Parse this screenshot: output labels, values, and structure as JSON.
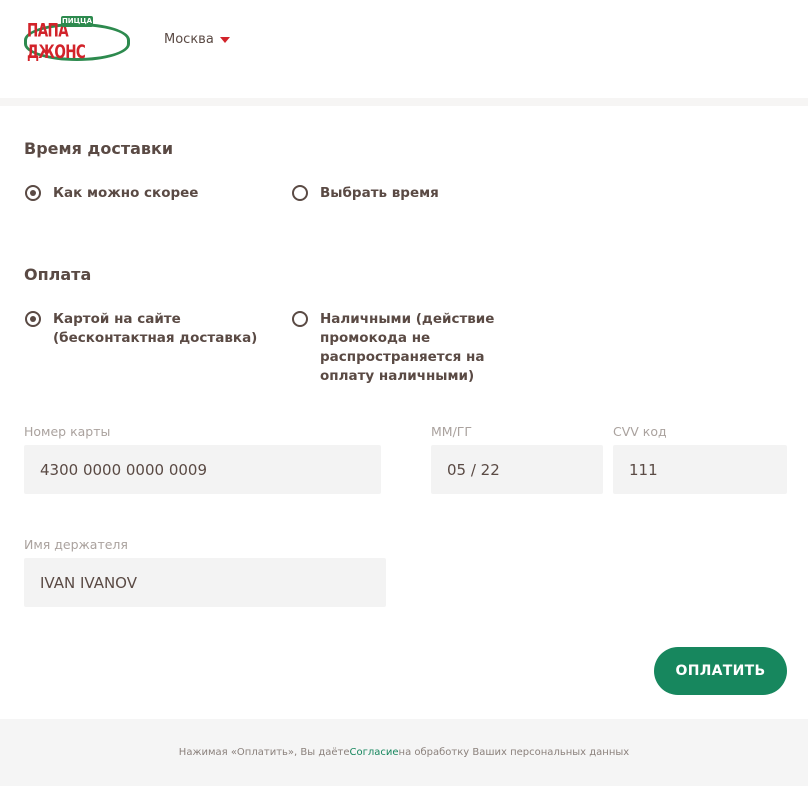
{
  "header": {
    "logo": {
      "banner": "ПИЦЦА",
      "text": "ПАПА ДЖОНС"
    },
    "city": "Москва"
  },
  "delivery": {
    "title": "Время доставки",
    "options": [
      {
        "label": "Как можно скорее",
        "checked": true
      },
      {
        "label": "Выбрать время",
        "checked": false
      }
    ]
  },
  "payment": {
    "title": "Оплата",
    "options": [
      {
        "label": "Картой на сайте (бесконтактная доставка)",
        "checked": true
      },
      {
        "label": "Наличными (действие промокода не распространяется на оплату наличными)",
        "checked": false
      }
    ]
  },
  "card": {
    "number_label": "Номер карты",
    "number_value": "4300 0000 0000 0009",
    "expiry_label": "ММ/ГГ",
    "expiry_value": "05 / 22",
    "cvv_label": "CVV код",
    "cvv_value": "111",
    "holder_label": "Имя держателя",
    "holder_value": "IVAN IVANOV"
  },
  "pay_button": "ОПЛАТИТЬ",
  "footer": {
    "text_before": "Нажимая «Оплатить», Вы даёте ",
    "link": "Согласие",
    "text_after": " на обработку Ваших персональных данных"
  },
  "colors": {
    "brand_green": "#17875e",
    "brand_red": "#d2232a",
    "text": "#5a4a44"
  }
}
